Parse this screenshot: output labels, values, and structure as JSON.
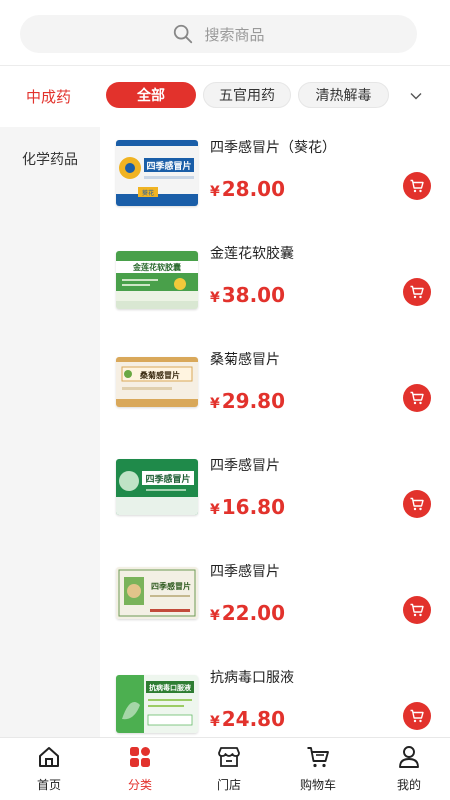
{
  "search": {
    "placeholder": "搜索商品",
    "icon": "search-icon"
  },
  "category": {
    "current": "中成药",
    "chips": [
      {
        "label": "全部",
        "active": true
      },
      {
        "label": "五官用药",
        "active": false
      },
      {
        "label": "清热解毒",
        "active": false
      }
    ],
    "expand_icon": "chevron-down-icon"
  },
  "sidebar": {
    "items": [
      {
        "label": "化学药品"
      }
    ]
  },
  "products": [
    {
      "name": "四季感冒片（葵花）",
      "price": "28.00",
      "currency": "¥"
    },
    {
      "name": "金莲花软胶囊",
      "price": "38.00",
      "currency": "¥"
    },
    {
      "name": "桑菊感冒片",
      "price": "29.80",
      "currency": "¥"
    },
    {
      "name": "四季感冒片",
      "price": "16.80",
      "currency": "¥"
    },
    {
      "name": "四季感冒片",
      "price": "22.00",
      "currency": "¥"
    },
    {
      "name": "抗病毒口服液",
      "price": "24.80",
      "currency": "¥"
    }
  ],
  "packaging": [
    {
      "label": "四季感冒片",
      "logo": "葵花"
    },
    {
      "label": "金莲花软胶囊"
    },
    {
      "label": "桑菊感冒片"
    },
    {
      "label": "四季感冒片"
    },
    {
      "label": "四季感冒片"
    },
    {
      "label": "抗病毒口服液"
    }
  ],
  "tabbar": {
    "items": [
      {
        "label": "首页",
        "icon": "home-icon",
        "active": false
      },
      {
        "label": "分类",
        "icon": "category-icon",
        "active": true
      },
      {
        "label": "门店",
        "icon": "store-icon",
        "active": false
      },
      {
        "label": "购物车",
        "icon": "cart-icon",
        "active": false
      },
      {
        "label": "我的",
        "icon": "user-icon",
        "active": false
      }
    ]
  },
  "colors": {
    "accent": "#e2322c",
    "sidebar_bg": "#f5f5f5",
    "search_bg": "#f4f4f4"
  }
}
